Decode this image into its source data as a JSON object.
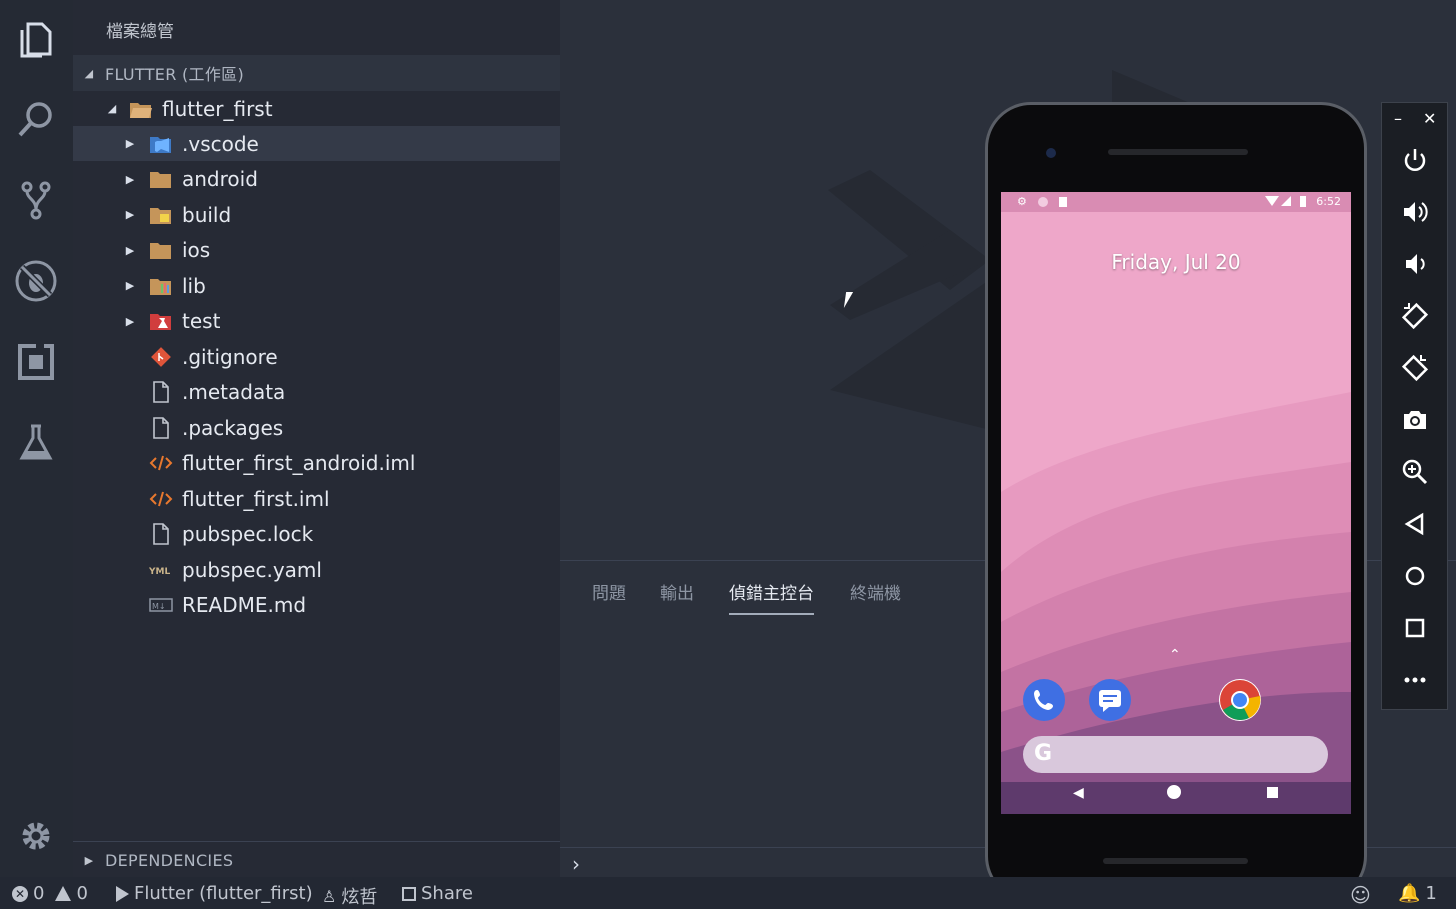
{
  "sidebar": {
    "title": "檔案總管",
    "workspace_header": "FLUTTER (工作區)",
    "dependencies_header": "DEPENDENCIES",
    "root_folder": "flutter_first",
    "items": [
      {
        "label": ".vscode",
        "icon": "vscode-folder-icon",
        "kind": "folder"
      },
      {
        "label": "android",
        "icon": "folder-icon",
        "kind": "folder"
      },
      {
        "label": "build",
        "icon": "build-folder-icon",
        "kind": "folder"
      },
      {
        "label": "ios",
        "icon": "folder-icon",
        "kind": "folder"
      },
      {
        "label": "lib",
        "icon": "lib-folder-icon",
        "kind": "folder"
      },
      {
        "label": "test",
        "icon": "test-folder-icon",
        "kind": "folder"
      },
      {
        "label": ".gitignore",
        "icon": "git-file-icon",
        "kind": "file"
      },
      {
        "label": ".metadata",
        "icon": "file-icon",
        "kind": "file"
      },
      {
        "label": ".packages",
        "icon": "file-icon",
        "kind": "file"
      },
      {
        "label": "flutter_first_android.iml",
        "icon": "xml-file-icon",
        "kind": "file"
      },
      {
        "label": "flutter_first.iml",
        "icon": "xml-file-icon",
        "kind": "file"
      },
      {
        "label": "pubspec.lock",
        "icon": "file-icon",
        "kind": "file"
      },
      {
        "label": "pubspec.yaml",
        "icon": "yaml-file-icon",
        "kind": "file"
      },
      {
        "label": "README.md",
        "icon": "markdown-file-icon",
        "kind": "file"
      }
    ]
  },
  "panel": {
    "tabs": [
      {
        "label": "問題"
      },
      {
        "label": "輸出"
      },
      {
        "label": "偵錯主控台"
      },
      {
        "label": "終端機"
      }
    ],
    "active_tab": "偵錯主控台"
  },
  "statusbar": {
    "errors": "0",
    "warnings": "0",
    "debug_target": "Flutter (flutter_first)",
    "user": "炫哲",
    "share": "Share",
    "notifications": "1"
  },
  "phone": {
    "date": "Friday, Jul 20",
    "time": "6:52",
    "search_logo": "G"
  },
  "colors": {
    "sidebar_bg": "#262a35",
    "editor_bg": "#2b303b",
    "wallpaper": "#eea7c9",
    "folder": "#c5955a"
  }
}
